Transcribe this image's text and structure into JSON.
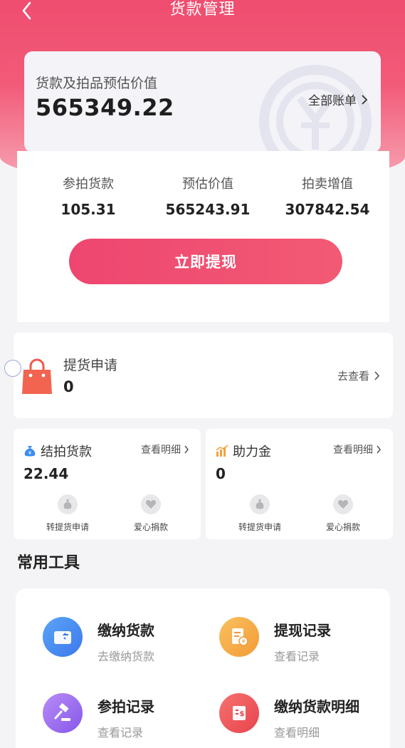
{
  "header": {
    "title": "货款管理"
  },
  "summary": {
    "label": "货款及拍品预估价值",
    "value": "565349.22",
    "all_bills": "全部账单"
  },
  "stats": [
    {
      "label": "参拍货款",
      "value": "105.31"
    },
    {
      "label": "预估价值",
      "value": "565243.91"
    },
    {
      "label": "拍卖增值",
      "value": "307842.54"
    }
  ],
  "withdraw_button": "立即提现",
  "pickup": {
    "title": "提货申请",
    "count": "0",
    "link": "去查看"
  },
  "settled": {
    "title": "结拍货款",
    "detail": "查看明细",
    "value": "22.44",
    "action1": "转提货申请",
    "action2": "爱心捐款"
  },
  "assist": {
    "title": "助力金",
    "detail": "查看明细",
    "value": "0",
    "action1": "转提货申请",
    "action2": "爱心捐款"
  },
  "tools": {
    "heading": "常用工具",
    "items": [
      {
        "title": "缴纳货款",
        "sub": "去缴纳货款",
        "icon": "wallet-icon",
        "color": "#4a8ff0"
      },
      {
        "title": "提现记录",
        "sub": "查看记录",
        "icon": "receipt-icon",
        "color": "#f5a640"
      },
      {
        "title": "参拍记录",
        "sub": "查看记录",
        "icon": "gavel-icon",
        "color": "#9b6cf0"
      },
      {
        "title": "缴纳货款明细",
        "sub": "查看明细",
        "icon": "bill-icon",
        "color": "#f05a5f"
      }
    ]
  },
  "colors": {
    "accent": "#ef4d6f",
    "background": "#f4f4f6"
  }
}
